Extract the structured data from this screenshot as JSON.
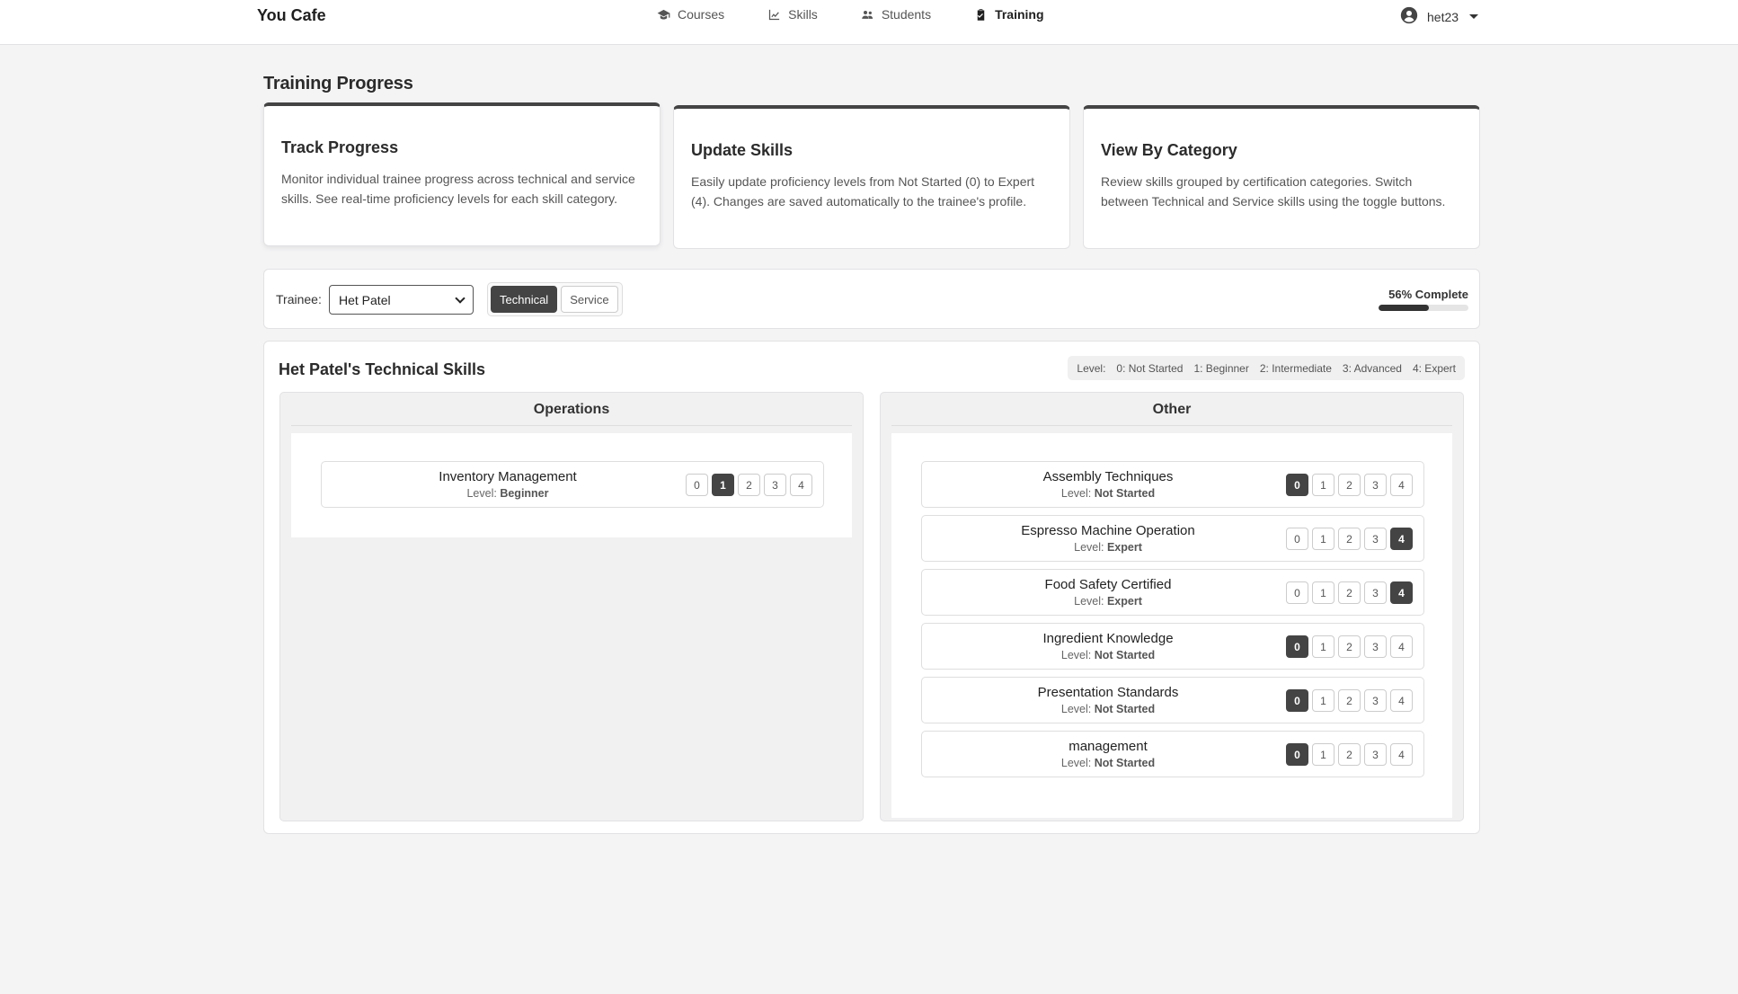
{
  "brand": "You Cafe",
  "nav": [
    {
      "label": "Courses",
      "icon": "graduation-cap-icon"
    },
    {
      "label": "Skills",
      "icon": "chart-line-icon"
    },
    {
      "label": "Students",
      "icon": "users-icon"
    },
    {
      "label": "Training",
      "icon": "clipboard-check-icon",
      "active": true
    }
  ],
  "user": {
    "name": "het23",
    "icon": "user-circle-icon"
  },
  "page_title": "Training Progress",
  "info_cards": [
    {
      "title": "Track Progress",
      "text": "Monitor individual trainee progress across technical and service skills. See real-time proficiency levels for each skill category."
    },
    {
      "title": "Update Skills",
      "text": "Easily update proficiency levels from Not Started (0) to Expert (4). Changes are saved automatically to the trainee's profile."
    },
    {
      "title": "View By Category",
      "text": "Review skills grouped by certification categories. Switch between Technical and Service skills using the toggle buttons."
    }
  ],
  "controls": {
    "trainee_label": "Trainee:",
    "trainee_selected": "Het Patel",
    "toggle": [
      "Technical",
      "Service"
    ],
    "toggle_active": "Technical",
    "progress_text": "56% Complete",
    "progress_percent": 56
  },
  "skills": {
    "title": "Het Patel's Technical Skills",
    "legend": [
      "Level:",
      "0: Not Started",
      "1: Beginner",
      "2: Intermediate",
      "3: Advanced",
      "4: Expert"
    ],
    "level_prefix": "Level:",
    "columns": [
      {
        "name": "Operations",
        "items": [
          {
            "name": "Inventory Management",
            "level_label": "Beginner",
            "level": 1
          }
        ]
      },
      {
        "name": "Other",
        "items": [
          {
            "name": "Assembly Techniques",
            "level_label": "Not Started",
            "level": 0
          },
          {
            "name": "Espresso Machine Operation",
            "level_label": "Expert",
            "level": 4
          },
          {
            "name": "Food Safety Certified",
            "level_label": "Expert",
            "level": 4
          },
          {
            "name": "Ingredient Knowledge",
            "level_label": "Not Started",
            "level": 0
          },
          {
            "name": "Presentation Standards",
            "level_label": "Not Started",
            "level": 0
          },
          {
            "name": "management",
            "level_label": "Not Started",
            "level": 0
          }
        ]
      }
    ],
    "level_buttons": [
      "0",
      "1",
      "2",
      "3",
      "4"
    ]
  },
  "colors": {
    "accent": "#444444",
    "background": "#f4f4f5"
  }
}
